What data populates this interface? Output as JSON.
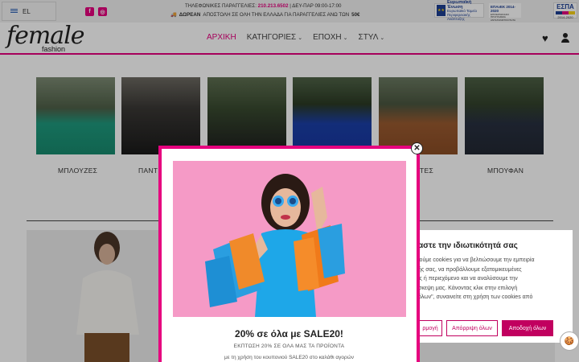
{
  "topbar": {
    "language": "EL",
    "phone_prefix": "ΤΗΛΕΦΩΝΙΚΕΣ ΠΑΡΑΓΓΕΛΙΕΣ:",
    "phone": "210.213.6502",
    "hours": "| ΔΕΥ-ΠΑΡ 09:00-17:00",
    "shipping_bold": "ΔΩΡΕΑΝ",
    "shipping_text": "ΑΠΟΣΤΟΛΗ ΣΕ ΟΛΗ ΤΗΝ ΕΛΛΑΔΑ ΓΙΑ ΠΑΡΑΓΓΕΛΙΕΣ ΑΝΩ ΤΩΝ",
    "shipping_amount": "50€",
    "eu_title": "Ευρωπαϊκή Ένωση",
    "eu_sub": "Ευρωπαϊκό Ταμείο Περιφερειακής Ανάπτυξης",
    "epan_title": "ΕΠΑνΕΚ 2014-2020",
    "epan_sub": "ΕΠΙΧΕΙΡΗΣΙΑΚΟ ΠΡΟΓΡΑΜΜΑ ΑΝΤΑΓΩΝΙΣΤΙΚΟΤΗΤΑ ΕΠΙΧΕΙΡΗΜΑΤΙΚΟΤΗΤΑ ΚΑΙΝΟΤΟΜΙΑ",
    "espa_title": "ΕΣΠΑ",
    "espa_sub": "2014-2020"
  },
  "header": {
    "logo_main": "female",
    "logo_sub": "fashion",
    "nav": [
      "ΑΡΧΙΚΗ",
      "ΚΑΤΗΓΟΡΙΕΣ",
      "ΕΠΟΧΗ",
      "ΣΤΥΛ"
    ]
  },
  "categories": [
    "ΜΠΛΟΥΖΕΣ",
    "ΠΑΝΤ",
    "ΤΕΣ",
    "ΜΠΟΥΦΑΝ"
  ],
  "popup": {
    "heading": "20% σε όλα με SALE20!",
    "subheading": "ΕΚΠΤΩΣΗ 20% ΣΕ ΟΛΑ ΜΑΣ ΤΑ ΠΡΟΪΟΝΤΑ",
    "body": "με τη χρήση του κουπονιού SALE20 στο καλάθι αγορών"
  },
  "cookie": {
    "title": "αστε την ιδιωτικότητά σας",
    "lines": [
      "ιούμε cookies για να βελτιώσουμε την εμπειρία",
      "ής σας, να προβάλλουμε εξατομικευμένες",
      "ις ή περιεχόμενο και να αναλύσουμε την",
      "σκεψη μας. Κάνοντας κλικ στην επιλογή",
      "όλων\", συναινείτε στη χρήση των cookies από"
    ],
    "btn_customize": "ρμογή",
    "btn_reject": "Απόρριψη όλων",
    "btn_accept": "Αποδοχή όλων"
  },
  "colors": {
    "brand": "#e6007e",
    "cookie_accent": "#c1005f"
  }
}
